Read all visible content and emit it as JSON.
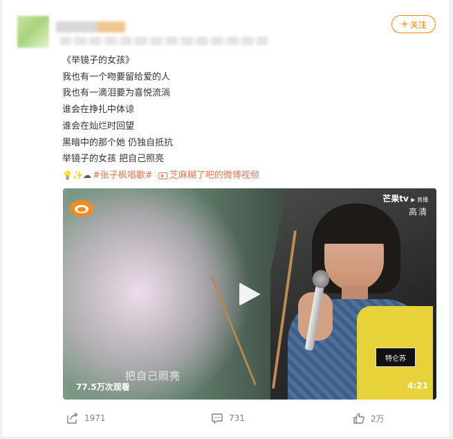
{
  "post": {
    "follow_label": "关注",
    "follow_plus": "+",
    "lines": [
      "《举镜子的女孩》",
      "我也有一个吻要留给爱的人",
      "我也有一滴泪要为喜悦流淌",
      "谁会在挣扎中体谅",
      "谁会在灿烂时回望",
      "黑暗中的那个她 仍独自抵抗",
      "举镜子的女孩 把自己照亮"
    ],
    "emoji": "💡✨☁",
    "topic": "#张子枫唱歌#",
    "video_link": "芝麻糊了吧的微博视频"
  },
  "video": {
    "broadcaster": "芒果tv",
    "broadcaster_sub": "▶ 直播",
    "quality": "高清",
    "patch_text": "特仑苏",
    "subtitle": "把自己照亮",
    "views": "77.5万次观看",
    "duration": "4:21"
  },
  "actions": {
    "repost_count": "1971",
    "comment_count": "731",
    "like_count": "2万"
  },
  "colors": {
    "accent": "#ff8200",
    "link": "#eb7350",
    "muted": "#808080"
  }
}
